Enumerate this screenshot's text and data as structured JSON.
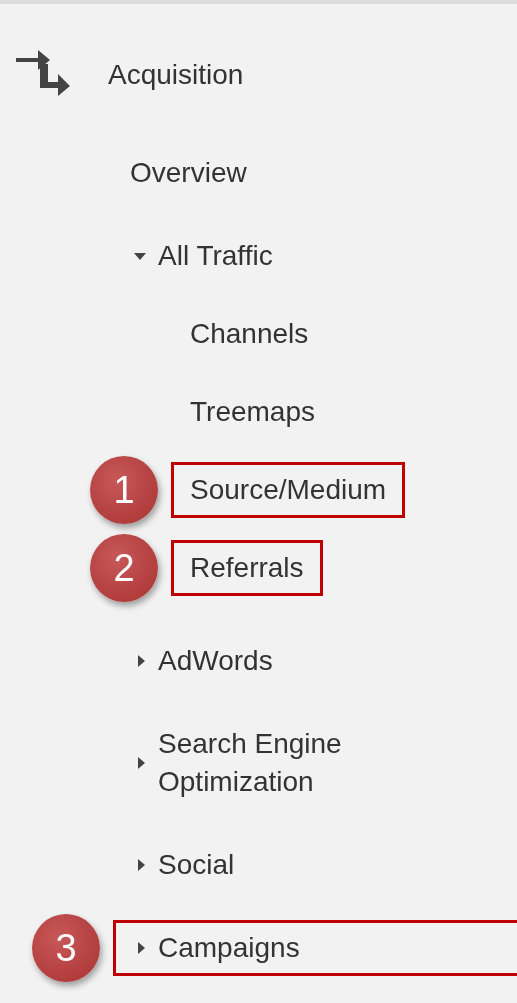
{
  "header": {
    "title": "Acquisition"
  },
  "items": [
    {
      "kind": "link",
      "label": "Overview"
    },
    {
      "kind": "group",
      "label": "All Traffic",
      "expanded": true,
      "children": [
        {
          "label": "Channels"
        },
        {
          "label": "Treemaps"
        },
        {
          "label": "Source/Medium",
          "callout": "1"
        },
        {
          "label": "Referrals",
          "callout": "2"
        }
      ]
    },
    {
      "kind": "group",
      "label": "AdWords",
      "expanded": false
    },
    {
      "kind": "group",
      "label": "Search Engine Optimization",
      "expanded": false
    },
    {
      "kind": "group",
      "label": "Social",
      "expanded": false
    },
    {
      "kind": "group",
      "label": "Campaigns",
      "expanded": false,
      "callout": "3"
    }
  ]
}
